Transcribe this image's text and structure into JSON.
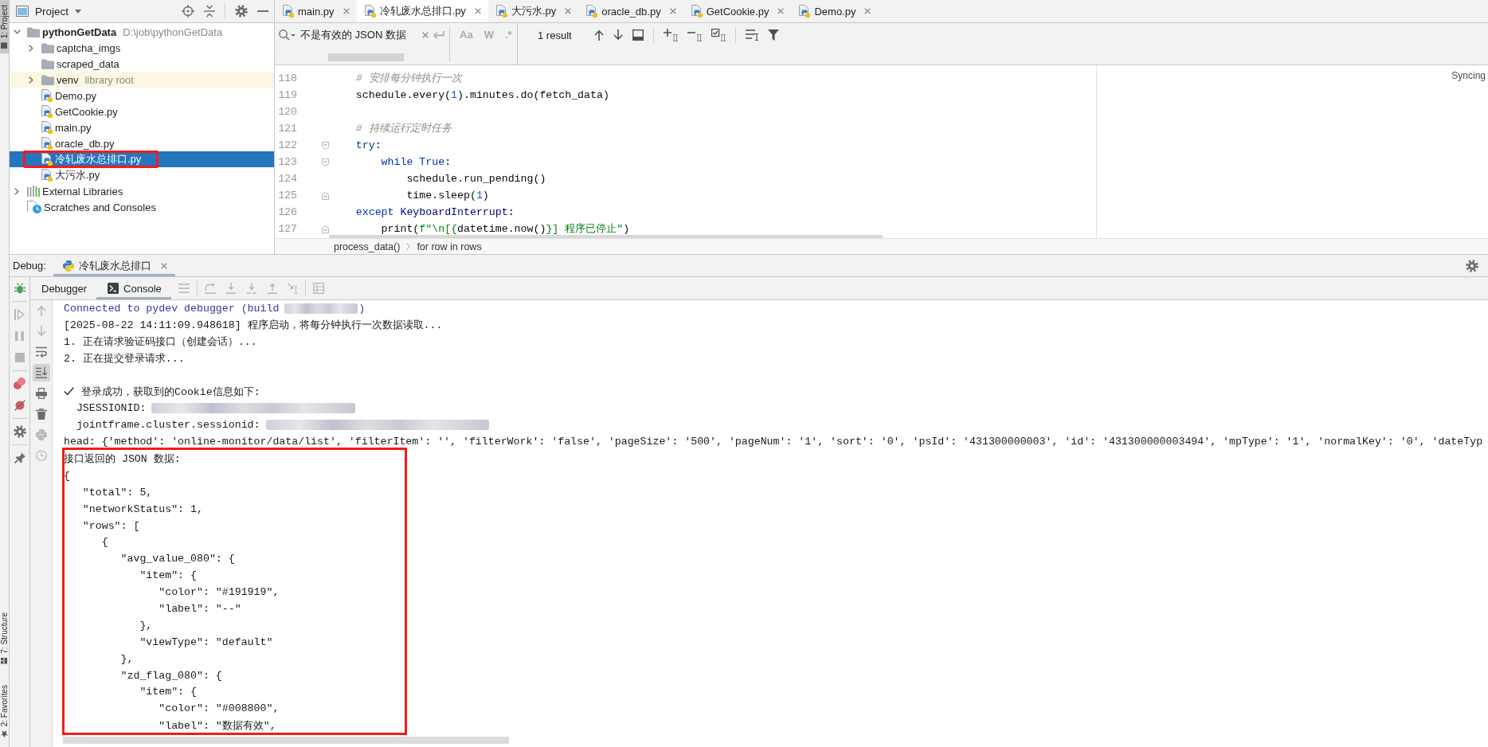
{
  "tool_strip": {
    "top": [
      {
        "label": "1: Project",
        "kind": "project",
        "selected": true
      }
    ],
    "bottom": [
      {
        "label": "7: Structure",
        "kind": "structure",
        "selected": false
      },
      {
        "label": "2: Favorites",
        "kind": "favorites",
        "selected": false
      }
    ]
  },
  "project": {
    "title": "Project",
    "tree": [
      {
        "label": "pythonGetData",
        "path": "D:\\job\\pythonGetData",
        "kind": "project",
        "expanded": true,
        "selected": false,
        "marked": false,
        "children": [
          {
            "label": "captcha_imgs",
            "kind": "folder",
            "expanded": false,
            "selected": false,
            "marked": false
          },
          {
            "label": "scraped_data",
            "kind": "folder",
            "selected": false,
            "marked": false
          },
          {
            "label": "venv",
            "note": "library root",
            "kind": "library_root",
            "expanded": false,
            "selected": false,
            "marked": false
          },
          {
            "label": "Demo.py",
            "kind": "python",
            "selected": false,
            "marked": false
          },
          {
            "label": "GetCookie.py",
            "kind": "python",
            "selected": false,
            "marked": false
          },
          {
            "label": "main.py",
            "kind": "python",
            "selected": false,
            "marked": false
          },
          {
            "label": "oracle_db.py",
            "kind": "python",
            "selected": false,
            "marked": false
          },
          {
            "label": "冷轧废水总排口.py",
            "kind": "python",
            "selected": true,
            "marked": true
          },
          {
            "label": "大污水.py",
            "kind": "python",
            "selected": false,
            "marked": false
          }
        ]
      },
      {
        "label": "External Libraries",
        "kind": "libraries",
        "expanded": false,
        "selected": false,
        "marked": false
      },
      {
        "label": "Scratches and Consoles",
        "kind": "scratches",
        "selected": false,
        "marked": false
      }
    ]
  },
  "editor": {
    "tabs": [
      {
        "label": "main.py",
        "selected": false
      },
      {
        "label": "冷轧废水总排口.py",
        "selected": true
      },
      {
        "label": "大污水.py",
        "selected": false
      },
      {
        "label": "oracle_db.py",
        "selected": false
      },
      {
        "label": "GetCookie.py",
        "selected": false
      },
      {
        "label": "Demo.py",
        "selected": false
      }
    ],
    "find": {
      "value": "不是有效的 JSON 数据",
      "options": [
        {
          "label": "Aa",
          "selected": false
        },
        {
          "label": "W",
          "selected": false
        },
        {
          "label": ".*",
          "selected": false
        }
      ],
      "result": "1 result"
    },
    "lines": [
      {
        "number": "118",
        "kind": "plain",
        "tokens": [
          {
            "kind": "comment",
            "text": "    # 安排每分钟执行一次"
          }
        ]
      },
      {
        "number": "119",
        "kind": "plain",
        "tokens": [
          {
            "kind": "plain",
            "text": "    schedule.every("
          },
          {
            "kind": "number",
            "text": "1"
          },
          {
            "kind": "plain",
            "text": ").minutes.do(fetch_data)"
          }
        ]
      },
      {
        "number": "120",
        "kind": "plain"
      },
      {
        "number": "121",
        "kind": "plain",
        "tokens": [
          {
            "kind": "comment",
            "text": "    # 持续运行定时任务"
          }
        ]
      },
      {
        "number": "122",
        "kind": "fold_start",
        "tokens": [
          {
            "kind": "keyword",
            "text": "    try"
          },
          {
            "kind": "plain",
            "text": ":"
          }
        ]
      },
      {
        "number": "123",
        "kind": "fold_start",
        "tokens": [
          {
            "kind": "keyword",
            "text": "        while True"
          },
          {
            "kind": "plain",
            "text": ":"
          }
        ]
      },
      {
        "number": "124",
        "kind": "plain",
        "tokens": [
          {
            "kind": "plain",
            "text": "            schedule.run_pending()"
          }
        ]
      },
      {
        "number": "125",
        "kind": "fold_end",
        "tokens": [
          {
            "kind": "plain",
            "text": "            time.sleep("
          },
          {
            "kind": "number",
            "text": "1"
          },
          {
            "kind": "plain",
            "text": ")"
          }
        ]
      },
      {
        "number": "126",
        "kind": "plain",
        "tokens": [
          {
            "kind": "keyword",
            "text": "    except"
          },
          {
            "kind": "builtin",
            "text": " KeyboardInterrupt"
          },
          {
            "kind": "plain",
            "text": ":"
          }
        ]
      },
      {
        "number": "127",
        "kind": "fold_end",
        "tokens": [
          {
            "kind": "plain",
            "text": "        print("
          },
          {
            "kind": "string",
            "text": "f\"\\n[{"
          },
          {
            "kind": "plain",
            "text": "datetime.now()"
          },
          {
            "kind": "string",
            "text": "}] 程序已停止\""
          },
          {
            "kind": "plain",
            "text": ")"
          }
        ]
      }
    ],
    "notice": "Syncing",
    "breadcrumbs": [
      "process_data()",
      "for row in rows"
    ]
  },
  "debug": {
    "title": "Debug:",
    "run_tabs": [
      {
        "label": "冷轧废水总排口",
        "selected": true
      }
    ],
    "left_toolbar": [
      [
        {
          "kind": "bug",
          "disabled": false
        }
      ],
      [
        {
          "kind": "resume",
          "disabled": true
        },
        {
          "kind": "pause",
          "disabled": true
        },
        {
          "kind": "stop",
          "disabled": true
        }
      ],
      [
        {
          "kind": "breakpoints",
          "disabled": false
        },
        {
          "kind": "mute",
          "disabled": false
        }
      ],
      [
        {
          "kind": "settings",
          "disabled": false
        }
      ],
      [
        {
          "kind": "pin",
          "disabled": false
        }
      ]
    ],
    "view_tabs": [
      {
        "label": "Debugger",
        "kind": "plain",
        "selected": false
      },
      {
        "label": "Console",
        "kind": "console",
        "selected": true
      }
    ],
    "step_toolbar": [
      [
        {
          "kind": "menu",
          "disabled": true
        }
      ],
      [
        {
          "kind": "execution_point",
          "disabled": true
        },
        {
          "kind": "step_into",
          "disabled": true
        },
        {
          "kind": "step_into_my_code",
          "disabled": true
        },
        {
          "kind": "step_out",
          "disabled": true
        },
        {
          "kind": "run_to_cursor",
          "disabled": true
        }
      ],
      [
        {
          "kind": "evaluate",
          "disabled": true
        }
      ]
    ],
    "console_toolbar": [
      {
        "kind": "up",
        "disabled": true,
        "on": false
      },
      {
        "kind": "down",
        "disabled": true,
        "on": false
      },
      {
        "kind": "wrap",
        "disabled": false,
        "on": false
      },
      {
        "kind": "scroll_end",
        "disabled": false,
        "on": true
      },
      {
        "kind": "print",
        "disabled": false,
        "on": false
      },
      {
        "kind": "trash",
        "disabled": false,
        "on": false
      },
      {
        "kind": "python_console",
        "disabled": true,
        "on": false
      },
      {
        "kind": "clock",
        "disabled": true,
        "on": false
      }
    ],
    "console": {
      "lines": [
        {
          "kind": "system",
          "parts": [
            {
              "kind": "text",
              "text": "Connected to pydev debugger (build"
            },
            {
              "kind": "blur"
            },
            {
              "kind": "text",
              "text": ")"
            }
          ]
        },
        {
          "kind": "output",
          "text": "[2025-08-22 14:11:09.948618] 程序启动，将每分钟执行一次数据读取..."
        },
        {
          "kind": "output",
          "text": "1. 正在请求验证码接口（创建会话）..."
        },
        {
          "kind": "output",
          "text": "2. 正在提交登录请求..."
        },
        {
          "kind": "output"
        },
        {
          "kind": "output",
          "parts": [
            {
              "kind": "check"
            },
            {
              "kind": "text",
              "text": "登录成功，获取到的Cookie信息如下:"
            }
          ]
        },
        {
          "kind": "output",
          "parts": [
            {
              "kind": "text",
              "text": "  JSESSIONID:"
            },
            {
              "kind": "blur"
            }
          ]
        },
        {
          "kind": "output",
          "parts": [
            {
              "kind": "text",
              "text": "  jointframe.cluster.sessionid:"
            },
            {
              "kind": "blur"
            }
          ]
        },
        {
          "kind": "output",
          "text": "head: {'method': 'online-monitor/data/list', 'filterItem': '', 'filterWork': 'false', 'pageSize': '500', 'pageNum': '1', 'sort': '0', 'psId': '431300000003', 'id': '431300000003494', 'mpType': '1', 'normalKey': '0', 'dateTyp"
        }
      ],
      "marked_lines": [
        {
          "kind": "output",
          "text": "接口返回的 JSON 数据:"
        },
        {
          "kind": "output",
          "text": "{"
        },
        {
          "kind": "output",
          "text": "   \"total\": 5,"
        },
        {
          "kind": "output",
          "text": "   \"networkStatus\": 1,"
        },
        {
          "kind": "output",
          "text": "   \"rows\": ["
        },
        {
          "kind": "output",
          "text": "      {"
        },
        {
          "kind": "output",
          "text": "         \"avg_value_080\": {"
        },
        {
          "kind": "output",
          "text": "            \"item\": {"
        },
        {
          "kind": "output",
          "text": "               \"color\": \"#191919\","
        },
        {
          "kind": "output",
          "text": "               \"label\": \"--\""
        },
        {
          "kind": "output",
          "text": "            },"
        },
        {
          "kind": "output",
          "text": "            \"viewType\": \"default\""
        },
        {
          "kind": "output",
          "text": "         },"
        },
        {
          "kind": "output",
          "text": "         \"zd_flag_080\": {"
        },
        {
          "kind": "output",
          "text": "            \"item\": {"
        },
        {
          "kind": "output",
          "text": "               \"color\": \"#008800\","
        },
        {
          "kind": "output",
          "text": "               \"label\": \"数据有效\","
        }
      ]
    }
  }
}
